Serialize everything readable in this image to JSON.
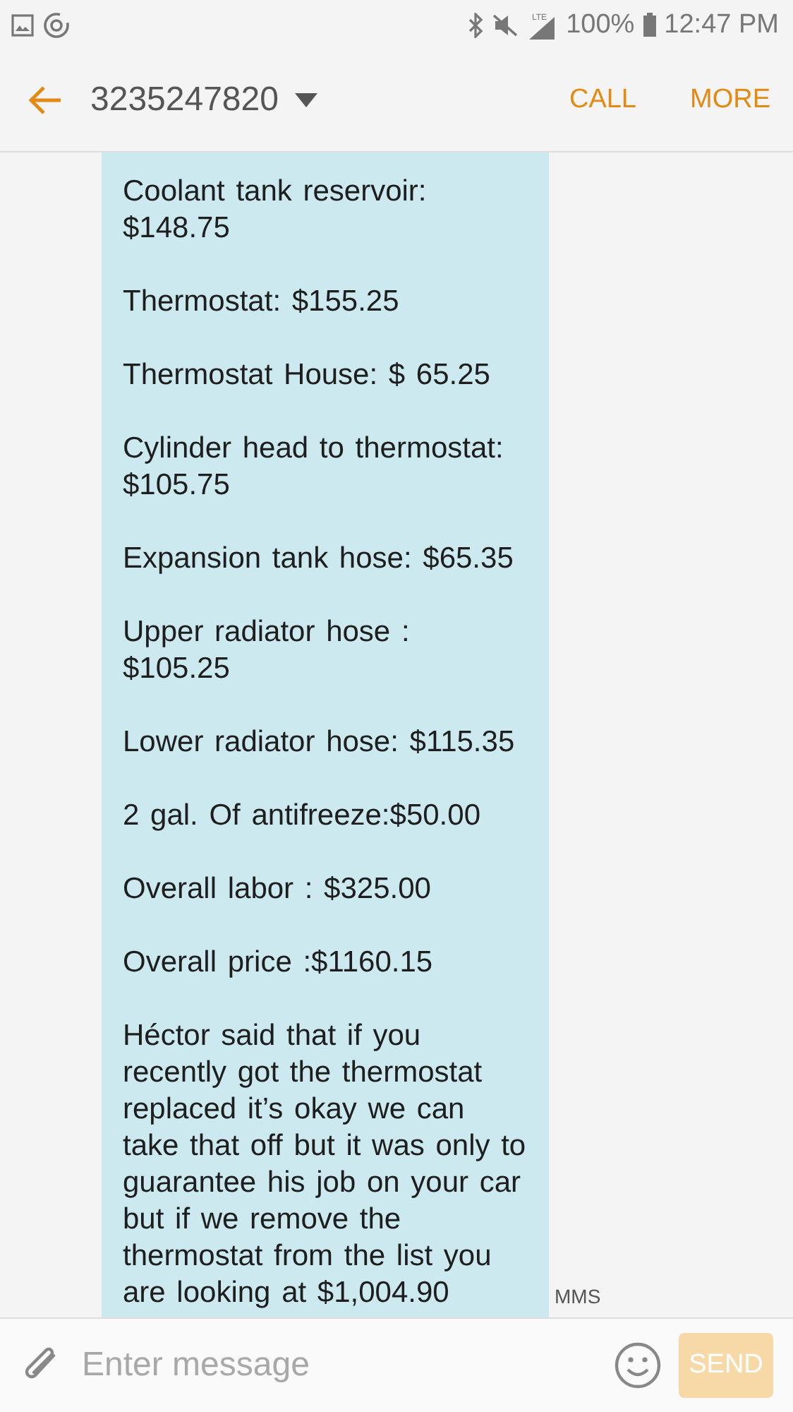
{
  "status_bar": {
    "battery": "100%",
    "time": "12:47 PM",
    "signal_label": "LTE"
  },
  "header": {
    "title": "3235247820",
    "actions": [
      "CALL",
      "MORE"
    ]
  },
  "message": {
    "paragraphs": [
      "Coolant tank reservoir: $148.75",
      "Thermostat: $155.25",
      "Thermostat House: $ 65.25",
      "Cylinder head to thermostat: $105.75",
      "Expansion tank hose: $65.35",
      "Upper radiator hose : $105.25",
      "Lower radiator hose: $115.35",
      "2 gal. Of antifreeze:$50.00",
      "Overall labor : $325.00",
      "Overall price :$1160.15",
      "Héctor said that if you recently got the thermostat replaced it’s okay we can take that off but it was only to guarantee his job on your car but if we remove the thermostat from the list you are looking at $1,004.90"
    ],
    "type_label": "MMS"
  },
  "composer": {
    "placeholder": "Enter message",
    "send": "SEND",
    "send_disabled": true
  }
}
